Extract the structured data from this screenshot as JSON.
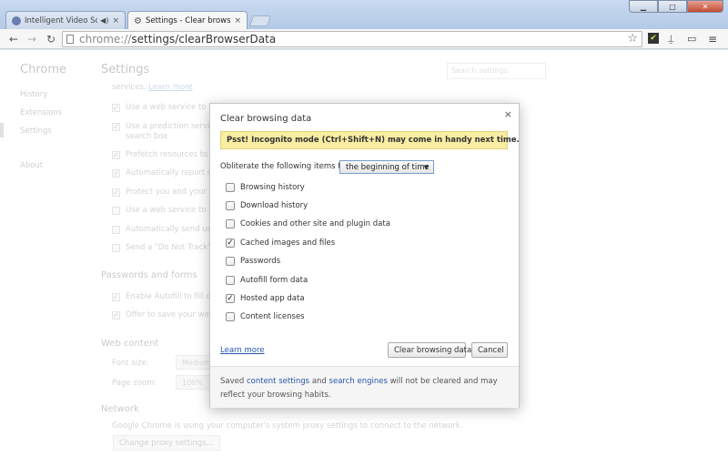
{
  "browser": {
    "tabs": [
      {
        "title": "Intelligent Video Soluti",
        "active": false
      },
      {
        "title": "Settings - Clear browsing",
        "active": true
      }
    ],
    "url_prefix": "chrome://",
    "url_path": "settings/clearBrowserData",
    "window_buttons": {
      "minimize": "▁",
      "maximize": "□",
      "close": "✕"
    }
  },
  "settings": {
    "sidebar_title": "Chrome",
    "sidebar_items": [
      "History",
      "Extensions",
      "Settings",
      "About"
    ],
    "title": "Settings",
    "search_placeholder": "Search settings",
    "privacy_line": "services.",
    "privacy_link": "Learn more",
    "privacy_items": [
      "Use a web service to help",
      "Use a prediction service t",
      "search box",
      "Prefetch resources to loac",
      "Automatically report detai",
      "Protect you and your devi",
      "Use a web service to help",
      "Automatically send usage",
      "Send a \"Do Not Track\" req"
    ],
    "passwords_heading": "Passwords and forms",
    "passwords_items": [
      "Enable Autofill to fill out",
      "Offer to save your web pa"
    ],
    "web_content_heading": "Web content",
    "font_size_label": "Font size:",
    "font_size_value": "Medium",
    "page_zoom_label": "Page zoom:",
    "page_zoom_value": "100%",
    "network_heading": "Network",
    "network_text": "Google Chrome is using your computer's system proxy settings to connect to the network.",
    "proxy_button": "Change proxy settings..."
  },
  "dialog": {
    "title": "Clear browsing data",
    "close": "×",
    "banner": "Psst! Incognito mode (Ctrl+Shift+N) may come in handy next time.",
    "obliterate_label": "Obliterate the following items from:",
    "time_range": "the beginning of time",
    "options": [
      {
        "label": "Browsing history",
        "checked": false
      },
      {
        "label": "Download history",
        "checked": false
      },
      {
        "label": "Cookies and other site and plugin data",
        "checked": false
      },
      {
        "label": "Cached images and files",
        "checked": true
      },
      {
        "label": "Passwords",
        "checked": false
      },
      {
        "label": "Autofill form data",
        "checked": false
      },
      {
        "label": "Hosted app data",
        "checked": true
      },
      {
        "label": "Content licenses",
        "checked": false
      }
    ],
    "learn_more": "Learn more",
    "clear_button": "Clear browsing data",
    "cancel_button": "Cancel",
    "footer": {
      "text1": "Saved ",
      "link1": "content settings",
      "text2": " and ",
      "link2": "search engines",
      "text3": " will not be cleared and may reflect your browsing habits."
    }
  }
}
